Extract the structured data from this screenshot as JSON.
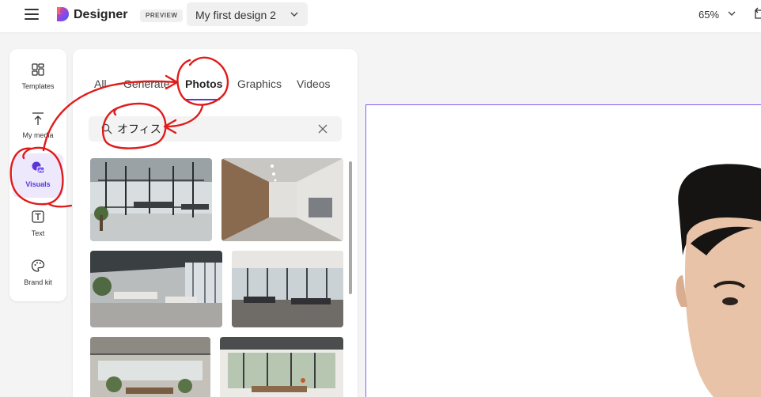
{
  "header": {
    "brand": "Designer",
    "badge": "PREVIEW",
    "design_title": "My first design 2",
    "zoom": "65%"
  },
  "rail": {
    "items": [
      {
        "label": "Templates",
        "icon": "templates-icon"
      },
      {
        "label": "My media",
        "icon": "upload-icon"
      },
      {
        "label": "Visuals",
        "icon": "visuals-icon",
        "active": true
      },
      {
        "label": "Text",
        "icon": "text-icon"
      },
      {
        "label": "Brand kit",
        "icon": "palette-icon"
      }
    ]
  },
  "panel": {
    "tabs": [
      "All",
      "Generate",
      "Photos",
      "Graphics",
      "Videos"
    ],
    "active_tab": "Photos",
    "search": {
      "value": "オフィス"
    }
  },
  "colors": {
    "accent": "#5b36d6",
    "canvas_border": "#8a5cf5",
    "annotation": "#e01b1b"
  }
}
